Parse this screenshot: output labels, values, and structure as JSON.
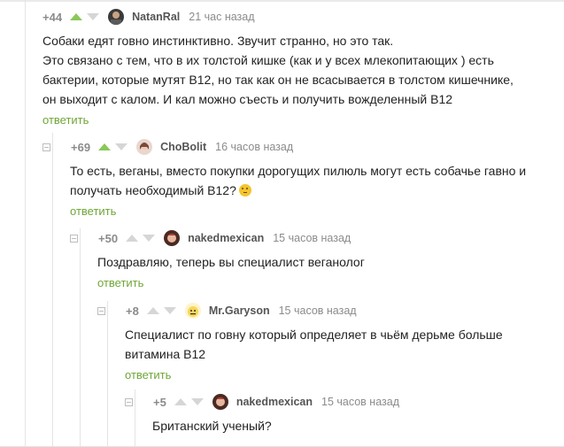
{
  "comments": [
    {
      "rating": "+44",
      "username": "NatanRal",
      "time": "21 час назад",
      "lines": [
        "Собаки едят говно инстинктивно. Звучит странно, но это так.",
        "Это связано с тем, что в их толстой кишке (как и у всех млекопитающих ) есть",
        "бактерии, которые мутят B12, но так как он не всасывается в толстом кишечнике,",
        "он выходит с калом. И кал можно съесть и получить вожделенный B12"
      ],
      "reply": "ответить",
      "upvote_active": true,
      "avatar_icon": "avatar-man-icon"
    },
    {
      "rating": "+69",
      "username": "ChoBolit",
      "time": "16 часов назад",
      "lines": [
        "То есть, веганы, вместо покупки дорогущих пилюль могут есть собачье гавно и",
        "получать необходимый B12?"
      ],
      "emoji": "thinking-face-emoji",
      "reply": "ответить",
      "upvote_active": true,
      "avatar_icon": "avatar-woman-icon"
    },
    {
      "rating": "+50",
      "username": "nakedmexican",
      "time": "15 часов назад",
      "lines": [
        "Поздравляю, теперь вы специалист веганолог"
      ],
      "reply": "ответить",
      "upvote_active": false,
      "avatar_icon": "avatar-redhead-icon"
    },
    {
      "rating": "+8",
      "username": "Mr.Garyson",
      "time": "15 часов назад",
      "lines": [
        "Специалист по говну который определяет в чьём дерьме больше",
        "витамина B12"
      ],
      "reply": "ответить",
      "upvote_active": false,
      "avatar_icon": "avatar-cartoon-icon"
    },
    {
      "rating": "+5",
      "username": "nakedmexican",
      "time": "15 часов назад",
      "lines": [
        "Британский ученый?"
      ],
      "upvote_active": false,
      "avatar_icon": "avatar-redhead-icon"
    }
  ],
  "colors": {
    "reply": "#6fa637",
    "upvote_active": "#8ac858",
    "arrow_inactive": "#d6d6d6"
  }
}
